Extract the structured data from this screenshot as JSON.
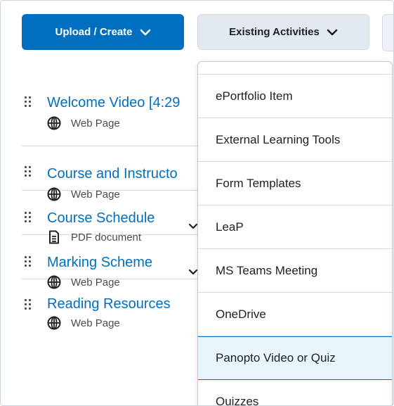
{
  "toolbar": {
    "upload_label": "Upload / Create",
    "existing_label": "Existing Activities"
  },
  "content_items": [
    {
      "title": "Welcome Video [4:29",
      "type": "Web Page",
      "icon": "globe-icon"
    },
    {
      "title": "Course and Instructo",
      "type": "Web Page",
      "icon": "globe-icon"
    },
    {
      "title": "Course Schedule",
      "type": "PDF document",
      "icon": "document-icon"
    },
    {
      "title": "Marking Scheme",
      "type": "Web Page",
      "icon": "globe-icon"
    },
    {
      "title": "Reading Resources",
      "type": "Web Page",
      "icon": "globe-icon"
    }
  ],
  "dropdown": {
    "items": [
      "ePortfolio Item",
      "External Learning Tools",
      "Form Templates",
      "LeaP",
      "MS Teams Meeting",
      "OneDrive",
      "Panopto Video or Quiz",
      "Quizzes"
    ],
    "highlighted": "Panopto Video or Quiz"
  },
  "colors": {
    "primary": "#006fbf",
    "link": "#006fbf",
    "highlight_bg": "#e8f6fc"
  }
}
